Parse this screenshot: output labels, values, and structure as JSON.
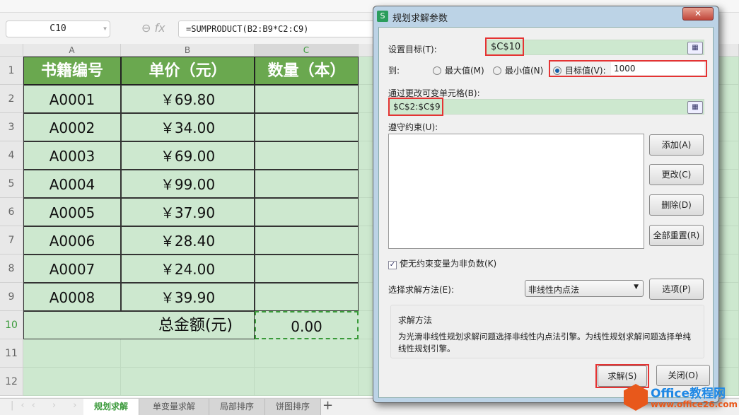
{
  "name_box": "C10",
  "formula": "=SUMPRODUCT(B2:B9*C2:C9)",
  "columns": [
    "A",
    "B",
    "C"
  ],
  "rows": [
    "1",
    "2",
    "3",
    "4",
    "5",
    "6",
    "7",
    "8",
    "9",
    "10",
    "11",
    "12"
  ],
  "headers": [
    "书籍编号",
    "单价（元）",
    "数量（本）"
  ],
  "data": [
    [
      "A0001",
      "￥69.80"
    ],
    [
      "A0002",
      "￥34.00"
    ],
    [
      "A0003",
      "￥69.00"
    ],
    [
      "A0004",
      "￥99.00"
    ],
    [
      "A0005",
      "￥37.90"
    ],
    [
      "A0006",
      "￥28.40"
    ],
    [
      "A0007",
      "￥24.00"
    ],
    [
      "A0008",
      "￥39.90"
    ]
  ],
  "total_label": "总金额(元)",
  "total_value": "0.00",
  "sheet_tabs": [
    "规划求解",
    "单变量求解",
    "局部排序",
    "饼图排序"
  ],
  "add_sheet": "+",
  "dialog": {
    "title": "规划求解参数",
    "icon": "S",
    "close": "✕",
    "target_label": "设置目标(T):",
    "target_value": "$C$10",
    "to_label": "到:",
    "max": "最大值(M)",
    "min": "最小值(N)",
    "value_of": "目标值(V):",
    "value_input": "1000",
    "changing_label": "通过更改可变单元格(B):",
    "changing_value": "$C$2:$C$9",
    "constraints_label": "遵守约束(U):",
    "add": "添加(A)",
    "change": "更改(C)",
    "delete": "删除(D)",
    "reset": "全部重置(R)",
    "nonneg": "使无约束变量为非负数(K)",
    "method_label": "选择求解方法(E):",
    "method_value": "非线性内点法",
    "options": "选项(P)",
    "desc_title": "求解方法",
    "desc_text": "为光滑非线性规划求解问题选择非线性内点法引擎。为线性规划求解问题选择单纯线性规划引擎。",
    "solve": "求解(S)",
    "close_btn": "关闭(O)"
  },
  "watermark": {
    "name": "Office教程网",
    "url": "www.office26.com"
  }
}
